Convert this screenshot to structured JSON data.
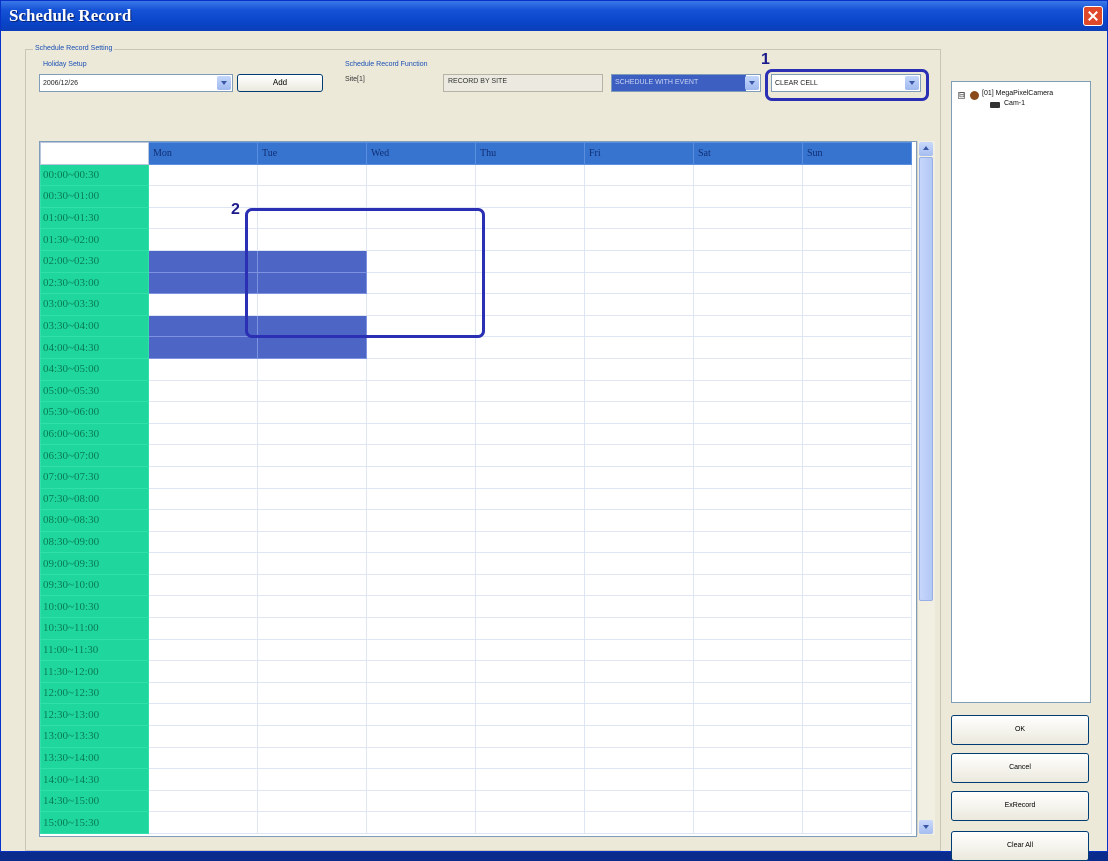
{
  "window": {
    "title": "Schedule Record"
  },
  "schedule_setting": {
    "group_label": "Schedule Record Setting",
    "holiday_label": "Holiday Setup",
    "holiday_value": "2006/12/26",
    "add_label": "Add",
    "function_label": "Schedule Record Function",
    "site_text": "Site[1]",
    "record_by_site": "RECORD BY SITE",
    "schedule_mode": "SCHEDULE WITH EVENT",
    "cell_action": "CLEAR CELL"
  },
  "callouts": {
    "one": "1",
    "two": "2"
  },
  "grid": {
    "days": [
      "Mon",
      "Tue",
      "Wed",
      "Thu",
      "Fri",
      "Sat",
      "Sun"
    ],
    "times": [
      "00:00~00:30",
      "00:30~01:00",
      "01:00~01:30",
      "01:30~02:00",
      "02:00~02:30",
      "02:30~03:00",
      "03:00~03:30",
      "03:30~04:00",
      "04:00~04:30",
      "04:30~05:00",
      "05:00~05:30",
      "05:30~06:00",
      "06:00~06:30",
      "06:30~07:00",
      "07:00~07:30",
      "07:30~08:00",
      "08:00~08:30",
      "08:30~09:00",
      "09:00~09:30",
      "09:30~10:00",
      "10:00~10:30",
      "10:30~11:00",
      "11:00~11:30",
      "11:30~12:00",
      "12:00~12:30",
      "12:30~13:00",
      "13:00~13:30",
      "13:30~14:00",
      "14:00~14:30",
      "14:30~15:00",
      "15:00~15:30"
    ],
    "selected_cells": [
      [
        4,
        1
      ],
      [
        4,
        2
      ],
      [
        5,
        1
      ],
      [
        5,
        2
      ],
      [
        7,
        1
      ],
      [
        7,
        2
      ],
      [
        8,
        1
      ],
      [
        8,
        2
      ]
    ],
    "colors": {
      "time_column": "#1fd79d",
      "header": "#3774cf",
      "selected": "#4d66c6"
    }
  },
  "tree": {
    "root": "[01] MegaPixelCamera",
    "child": "Cam-1",
    "expander": "⊟"
  },
  "buttons": {
    "ok": "OK",
    "cancel": "Cancel",
    "exrecord": "ExRecord",
    "clear_all": "Clear All"
  }
}
